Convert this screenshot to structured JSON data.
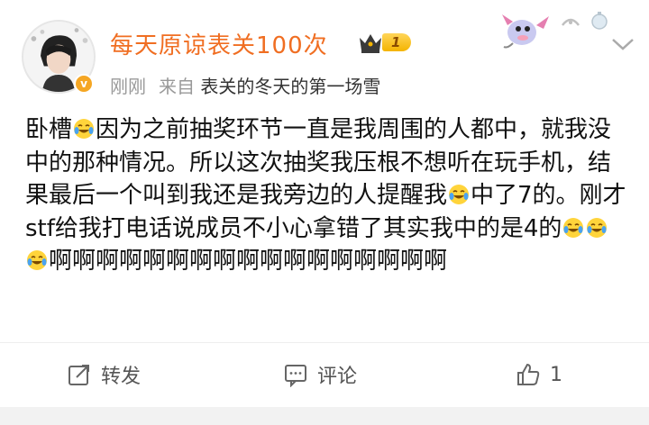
{
  "header": {
    "username": "每天原谅表关100次",
    "level": "1",
    "time": "刚刚",
    "from_label": "来自",
    "source": "表关的冬天的第一场雪"
  },
  "content": {
    "segments": [
      "卧槽",
      "因为之前抽奖环节一直是我周围的人都中，就我没中的那种情况。所以这次抽奖我压根不想听在玩手机，结果最后一个叫到我还是我旁边的人提醒我",
      "中了7的。刚才stf给我打电话说成员不小心拿错了其实我中的是4的",
      "啊啊啊啊啊啊啊啊啊啊啊啊啊啊啊啊啊"
    ],
    "emoji": "crying-laughing-emoji"
  },
  "actions": {
    "repost_label": "转发",
    "comment_label": "评论",
    "like_count": "1"
  },
  "colors": {
    "username": "#f06e22",
    "meta": "#999999",
    "badge": "#f4b400"
  }
}
